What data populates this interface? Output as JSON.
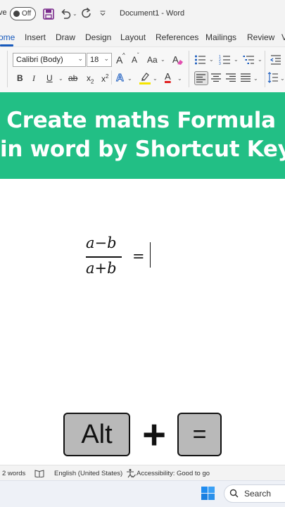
{
  "titlebar": {
    "autosave_label": "ve",
    "autosave_state": "Off",
    "document_title": "Document1  -  Word"
  },
  "tabs": [
    {
      "label": "ome",
      "active": true
    },
    {
      "label": "Insert"
    },
    {
      "label": "Draw"
    },
    {
      "label": "Design"
    },
    {
      "label": "Layout"
    },
    {
      "label": "References"
    },
    {
      "label": "Mailings"
    },
    {
      "label": "Review"
    },
    {
      "label": "V"
    }
  ],
  "ribbon": {
    "font_name": "Calibri (Body)",
    "font_size": "18",
    "grow_font": "A",
    "shrink_font": "A",
    "change_case": "Aa",
    "bold": "B",
    "italic": "I",
    "underline": "U",
    "strikethrough": "ab",
    "subscript": "x",
    "subscript_small": "2",
    "superscript": "x",
    "superscript_small": "2",
    "text_effects": "A",
    "font_color": "A",
    "highlight_color": "#f5e400",
    "font_color_bar": "#e02020"
  },
  "banner": {
    "line1": "Create maths Formula",
    "line2": "in word by Shortcut Key",
    "background": "#22bf85"
  },
  "document": {
    "numerator": "a−b",
    "denominator": "a+b",
    "equals": "="
  },
  "keys": {
    "alt_label": "Alt",
    "plus": "+",
    "equals_label": "="
  },
  "statusbar": {
    "words": "2 words",
    "language": "English (United States)",
    "accessibility": "Accessibility: Good to go"
  },
  "taskbar": {
    "search_label": "Search"
  }
}
